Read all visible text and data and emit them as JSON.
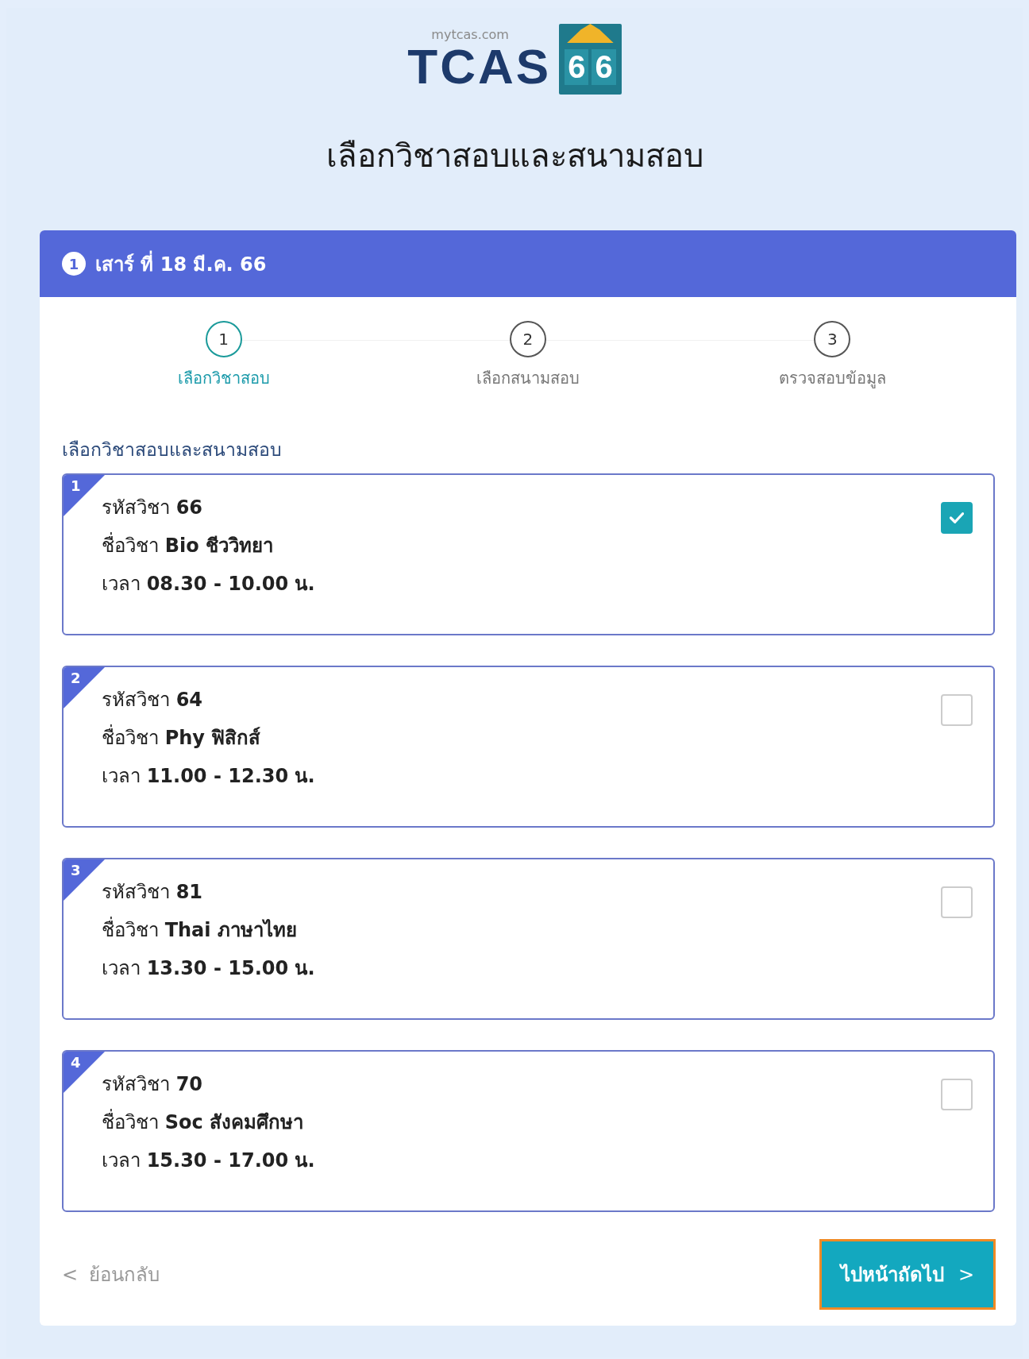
{
  "logo": {
    "site": "mytcas.com",
    "name": "TCAS",
    "digits": [
      "6",
      "6"
    ]
  },
  "title": "เลือกวิชาสอบและสนามสอบ",
  "day": {
    "number": "1",
    "label": "เสาร์ ที่ 18 มี.ค. 66"
  },
  "steps": [
    {
      "number": "1",
      "label": "เลือกวิชาสอบ",
      "selected": true
    },
    {
      "number": "2",
      "label": "เลือกสนามสอบ",
      "selected": false
    },
    {
      "number": "3",
      "label": "ตรวจสอบข้อมูล",
      "selected": false
    }
  ],
  "section_label": "เลือกวิชาสอบและสนามสอบ",
  "subjects": [
    {
      "number": "1",
      "code": "รหัสวิชา **66**",
      "name": "ชื่อวิชา **Bio ชีววิทยา**",
      "time": "เวลา **08.30 - 10.00 น.**",
      "checked": true
    },
    {
      "number": "2",
      "code": "รหัสวิชา **64**",
      "name": "ชื่อวิชา **Phy ฟิสิกส์**",
      "time": "เวลา **11.00 - 12.30 น.**",
      "checked": false
    },
    {
      "number": "3",
      "code": "รหัสวิชา **81**",
      "name": "ชื่อวิชา **Thai ภาษาไทย**",
      "time": "เวลา **13.30 - 15.00 น.**",
      "checked": false
    },
    {
      "number": "4",
      "code": "รหัสวิชา **70**",
      "name": "ชื่อวิชา **Soc สังคมศึกษา**",
      "time": "เวลา **15.30 - 17.00 น.**",
      "checked": false
    }
  ],
  "back": {
    "label": "ย้อนกลับ",
    "arrow": "<"
  },
  "next": {
    "label": "ไปหน้าถัดไป",
    "arrow": ">"
  }
}
